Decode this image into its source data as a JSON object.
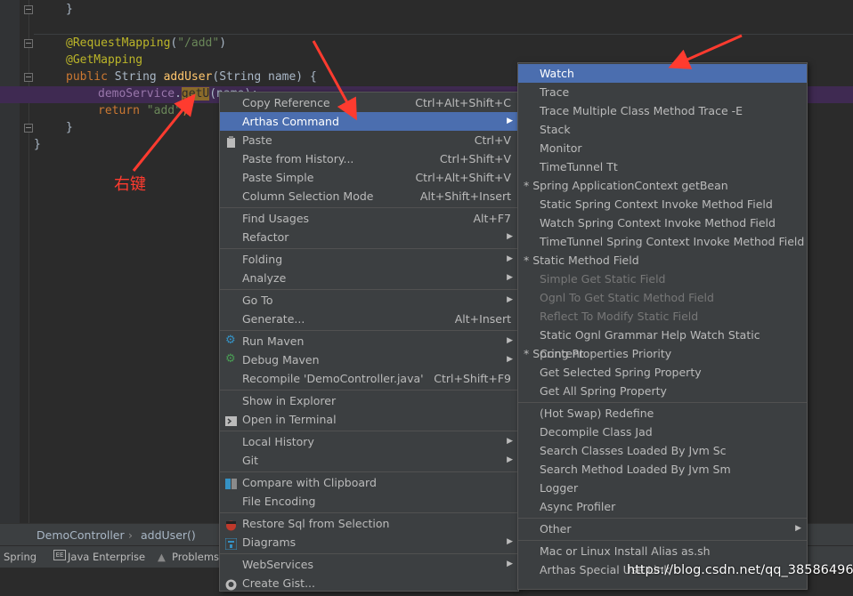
{
  "editor": {
    "lines": {
      "close1": "}",
      "annotation1": "@RequestMapping",
      "annotation1_open": "(",
      "annotation1_arg": "\"/add\"",
      "annotation1_close": ")",
      "annotation2": "@GetMapping",
      "kw_public": "public ",
      "type_string": "String ",
      "method": "addUser",
      "params": "(String name) {",
      "call_obj": "demoService",
      "call_dot": ".",
      "call_sel": "getU",
      "call_rest": "(name);",
      "kw_return": "return ",
      "return_str": "\"add\"",
      "semi": ";",
      "close2": "}",
      "close3": "}"
    },
    "annotation_label": "右键"
  },
  "breadcrumb": {
    "class": "DemoController",
    "sep": "›",
    "method": "addUser()"
  },
  "statusbar": {
    "spring": "Spring",
    "java_ee": "Java Enterprise",
    "problems": "Problems"
  },
  "context_menu": {
    "items": {
      "copy_reference": {
        "label": "Copy Reference",
        "shortcut": "Ctrl+Alt+Shift+C"
      },
      "arthas_command": {
        "label": "Arthas Command"
      },
      "paste": {
        "label": "Paste",
        "shortcut": "Ctrl+V"
      },
      "paste_history": {
        "label": "Paste from History...",
        "shortcut": "Ctrl+Shift+V"
      },
      "paste_simple": {
        "label": "Paste Simple",
        "shortcut": "Ctrl+Alt+Shift+V"
      },
      "column_selection": {
        "label": "Column Selection Mode",
        "shortcut": "Alt+Shift+Insert"
      },
      "find_usages": {
        "label": "Find Usages",
        "shortcut": "Alt+F7"
      },
      "refactor": {
        "label": "Refactor"
      },
      "folding": {
        "label": "Folding"
      },
      "analyze": {
        "label": "Analyze"
      },
      "go_to": {
        "label": "Go To"
      },
      "generate": {
        "label": "Generate...",
        "shortcut": "Alt+Insert"
      },
      "run_maven": {
        "label": "Run Maven"
      },
      "debug_maven": {
        "label": "Debug Maven"
      },
      "recompile": {
        "label": "Recompile 'DemoController.java'",
        "shortcut": "Ctrl+Shift+F9"
      },
      "show_explorer": {
        "label": "Show in Explorer"
      },
      "open_terminal": {
        "label": "Open in Terminal"
      },
      "local_history": {
        "label": "Local History"
      },
      "git": {
        "label": "Git"
      },
      "compare_clipboard": {
        "label": "Compare with Clipboard"
      },
      "file_encoding": {
        "label": "File Encoding"
      },
      "restore_sql": {
        "label": "Restore Sql from Selection"
      },
      "diagrams": {
        "label": "Diagrams"
      },
      "webservices": {
        "label": "WebServices"
      },
      "create_gist": {
        "label": "Create Gist..."
      }
    }
  },
  "arthas_submenu": {
    "items": {
      "watch": "Watch",
      "trace": "Trace",
      "trace_multi": "Trace Multiple Class Method Trace -E",
      "stack": "Stack",
      "monitor": "Monitor",
      "timetunnel": "TimeTunnel Tt",
      "spring_ctx_getbean": "* Spring ApplicationContext getBean",
      "static_spring_ctx": "Static Spring Context Invoke  Method Field",
      "watch_spring_ctx": "Watch Spring Context Invoke Method Field",
      "tt_spring_ctx": "TimeTunnel Spring Context Invoke Method Field",
      "static_method_field": "*  Static Method Field",
      "simple_get_static": "Simple Get Static Field",
      "ognl_static_method": "Ognl To Get Static Method Field",
      "reflect_modify": "Reflect To Modify Static Field",
      "static_ognl_help": "Static Ognl Grammar Help Watch Static Content",
      "spring_props_priority": "*  Spring Properties Priority",
      "get_selected_prop": "Get Selected Spring Property",
      "get_all_props": "Get All Spring Property",
      "hot_swap": "(Hot Swap)  Redefine",
      "decompile": "Decompile Class Jad",
      "search_classes": "Search Classes Loaded By Jvm Sc",
      "search_methods": "Search Method Loaded By Jvm Sm",
      "logger": "Logger",
      "async_profiler": "Async Profiler",
      "other": "Other",
      "mac_linux_alias": "Mac or Linux Install Alias as.sh",
      "arthas_special": "Arthas Special Use Link"
    }
  },
  "watermark": "https://blog.csdn.net/qq_38586496",
  "colors": {
    "menu_bg": "#3c3f41",
    "selection": "#4b6eaf",
    "annotation_red": "#ff3b2f"
  }
}
